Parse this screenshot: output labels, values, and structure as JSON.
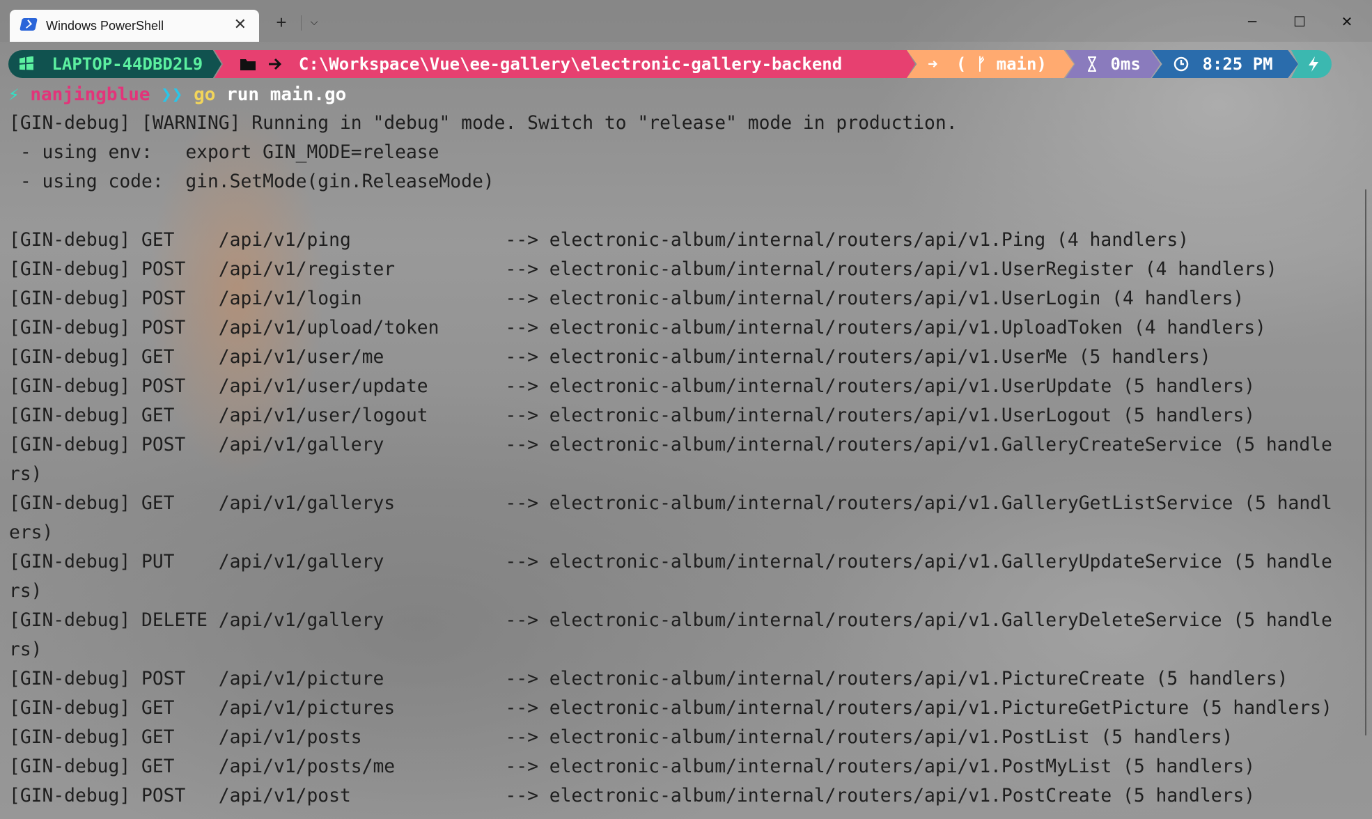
{
  "tab": {
    "title": "Windows PowerShell"
  },
  "window_controls": {
    "minimize": "─",
    "maximize": "☐",
    "close": "✕"
  },
  "titlebar": {
    "new_tab": "+",
    "dropdown": "⌵",
    "tab_close": "✕"
  },
  "prompt": {
    "host": "LAPTOP-44DBD2L9",
    "path": "C:\\Workspace\\Vue\\ee-gallery\\electronic-gallery-backend",
    "git": "( ᚠ main)",
    "git_arrow": "➜",
    "duration": "0ms",
    "time": "8:25 PM"
  },
  "command": {
    "user": "nanjingblue",
    "chevrons": "❯❯",
    "program": "go",
    "args": "run main.go"
  },
  "output": [
    "[GIN-debug] [WARNING] Running in \"debug\" mode. Switch to \"release\" mode in production.",
    " - using env:   export GIN_MODE=release",
    " - using code:  gin.SetMode(gin.ReleaseMode)",
    "",
    "[GIN-debug] GET    /api/v1/ping              --> electronic-album/internal/routers/api/v1.Ping (4 handlers)",
    "[GIN-debug] POST   /api/v1/register          --> electronic-album/internal/routers/api/v1.UserRegister (4 handlers)",
    "[GIN-debug] POST   /api/v1/login             --> electronic-album/internal/routers/api/v1.UserLogin (4 handlers)",
    "[GIN-debug] POST   /api/v1/upload/token      --> electronic-album/internal/routers/api/v1.UploadToken (4 handlers)",
    "[GIN-debug] GET    /api/v1/user/me           --> electronic-album/internal/routers/api/v1.UserMe (5 handlers)",
    "[GIN-debug] POST   /api/v1/user/update       --> electronic-album/internal/routers/api/v1.UserUpdate (5 handlers)",
    "[GIN-debug] GET    /api/v1/user/logout       --> electronic-album/internal/routers/api/v1.UserLogout (5 handlers)",
    "[GIN-debug] POST   /api/v1/gallery           --> electronic-album/internal/routers/api/v1.GalleryCreateService (5 handle",
    "rs)",
    "[GIN-debug] GET    /api/v1/gallerys          --> electronic-album/internal/routers/api/v1.GalleryGetListService (5 handl",
    "ers)",
    "[GIN-debug] PUT    /api/v1/gallery           --> electronic-album/internal/routers/api/v1.GalleryUpdateService (5 handle",
    "rs)",
    "[GIN-debug] DELETE /api/v1/gallery           --> electronic-album/internal/routers/api/v1.GalleryDeleteService (5 handle",
    "rs)",
    "[GIN-debug] POST   /api/v1/picture           --> electronic-album/internal/routers/api/v1.PictureCreate (5 handlers)",
    "[GIN-debug] GET    /api/v1/pictures          --> electronic-album/internal/routers/api/v1.PictureGetPicture (5 handlers)",
    "[GIN-debug] GET    /api/v1/posts             --> electronic-album/internal/routers/api/v1.PostList (5 handlers)",
    "[GIN-debug] GET    /api/v1/posts/me          --> electronic-album/internal/routers/api/v1.PostMyList (5 handlers)",
    "[GIN-debug] POST   /api/v1/post              --> electronic-album/internal/routers/api/v1.PostCreate (5 handlers)"
  ]
}
